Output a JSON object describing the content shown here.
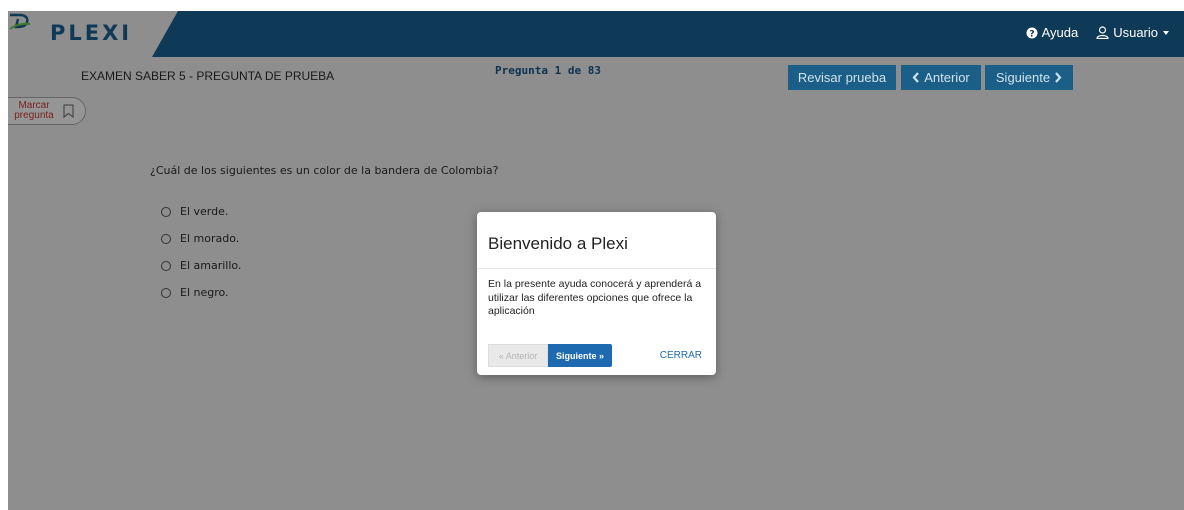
{
  "header": {
    "logo_text": "PLEXI",
    "help_label": "Ayuda",
    "user_label": "Usuario",
    "help_icon": "question-circle-icon",
    "user_icon": "user-icon",
    "caret_icon": "caret-down-icon"
  },
  "subbar": {
    "exam_title": "EXAMEN SABER 5 - PREGUNTA DE PRUEBA",
    "question_counter": "Pregunta 1 de 83",
    "review_label": "Revisar prueba",
    "prev_label": "Anterior",
    "next_label": "Siguiente"
  },
  "mark": {
    "label_line1": "Marcar",
    "label_line2": "pregunta",
    "icon": "bookmark-icon"
  },
  "question": {
    "text": "¿Cuál de los siguientes es un color de la bandera de Colombia?",
    "options": [
      "El verde.",
      "El morado.",
      "El amarillo.",
      "El negro."
    ]
  },
  "modal": {
    "title": "Bienvenido a Plexi",
    "body": "En la presente ayuda conocerá y aprenderá a utilizar las diferentes opciones que ofrece la aplicación",
    "prev_label": "« Anterior",
    "next_label": "Siguiente »",
    "close_label": "CERRAR"
  },
  "colors": {
    "topbar": "#0f3a57",
    "overlay": "#8e8e8e",
    "nav_button": "#1b5e87",
    "primary": "#1d6ab0"
  }
}
